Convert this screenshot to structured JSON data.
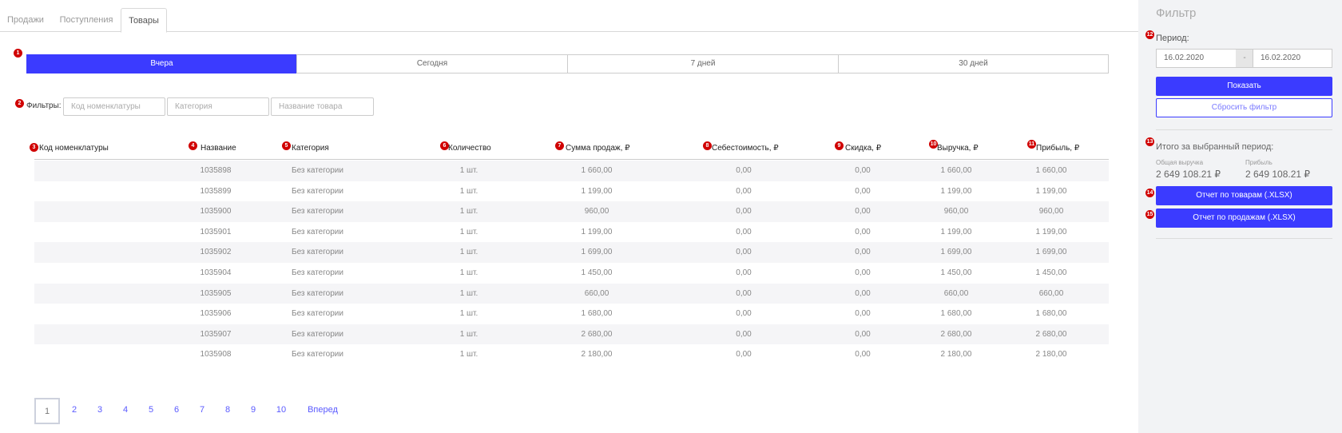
{
  "tabs": [
    "Продажи",
    "Поступления",
    "Товары"
  ],
  "markers": [
    "1",
    "2",
    "3",
    "4",
    "5",
    "6",
    "7",
    "8",
    "9",
    "10",
    "11",
    "12",
    "13",
    "14",
    "15"
  ],
  "periods": [
    "Вчера",
    "Сегодня",
    "7 дней",
    "30 дней"
  ],
  "filters": {
    "label": "Фильтры:",
    "code_placeholder": "Код номенклатуры",
    "category_placeholder": "Категория",
    "name_placeholder": "Название товара"
  },
  "columns": [
    "Код номенклатуры",
    "Название",
    "Категория",
    "Количество",
    "Сумма продаж, ₽",
    "Себестоимость, ₽",
    "Скидка, ₽",
    "Выручка, ₽",
    "Прибыль, ₽"
  ],
  "rows": [
    {
      "code": "",
      "name": "1035898",
      "category": "Без категории",
      "qty": "1 шт.",
      "sum": "1 660,00",
      "cost": "0,00",
      "discount": "0,00",
      "revenue": "1 660,00",
      "profit": "1 660,00"
    },
    {
      "code": "",
      "name": "1035899",
      "category": "Без категории",
      "qty": "1 шт.",
      "sum": "1 199,00",
      "cost": "0,00",
      "discount": "0,00",
      "revenue": "1 199,00",
      "profit": "1 199,00"
    },
    {
      "code": "",
      "name": "1035900",
      "category": "Без категории",
      "qty": "1 шт.",
      "sum": "960,00",
      "cost": "0,00",
      "discount": "0,00",
      "revenue": "960,00",
      "profit": "960,00"
    },
    {
      "code": "",
      "name": "1035901",
      "category": "Без категории",
      "qty": "1 шт.",
      "sum": "1 199,00",
      "cost": "0,00",
      "discount": "0,00",
      "revenue": "1 199,00",
      "profit": "1 199,00"
    },
    {
      "code": "",
      "name": "1035902",
      "category": "Без категории",
      "qty": "1 шт.",
      "sum": "1 699,00",
      "cost": "0,00",
      "discount": "0,00",
      "revenue": "1 699,00",
      "profit": "1 699,00"
    },
    {
      "code": "",
      "name": "1035904",
      "category": "Без категории",
      "qty": "1 шт.",
      "sum": "1 450,00",
      "cost": "0,00",
      "discount": "0,00",
      "revenue": "1 450,00",
      "profit": "1 450,00"
    },
    {
      "code": "",
      "name": "1035905",
      "category": "Без категории",
      "qty": "1 шт.",
      "sum": "660,00",
      "cost": "0,00",
      "discount": "0,00",
      "revenue": "660,00",
      "profit": "660,00"
    },
    {
      "code": "",
      "name": "1035906",
      "category": "Без категории",
      "qty": "1 шт.",
      "sum": "1 680,00",
      "cost": "0,00",
      "discount": "0,00",
      "revenue": "1 680,00",
      "profit": "1 680,00"
    },
    {
      "code": "",
      "name": "1035907",
      "category": "Без категории",
      "qty": "1 шт.",
      "sum": "2 680,00",
      "cost": "0,00",
      "discount": "0,00",
      "revenue": "2 680,00",
      "profit": "2 680,00"
    },
    {
      "code": "",
      "name": "1035908",
      "category": "Без категории",
      "qty": "1 шт.",
      "sum": "2 180,00",
      "cost": "0,00",
      "discount": "0,00",
      "revenue": "2 180,00",
      "profit": "2 180,00"
    }
  ],
  "pagination": {
    "pages": [
      "1",
      "2",
      "3",
      "4",
      "5",
      "6",
      "7",
      "8",
      "9",
      "10"
    ],
    "next": "Вперед"
  },
  "sidebar": {
    "title": "Фильтр",
    "period_label": "Период:",
    "date_from": "16.02.2020",
    "date_sep": "-",
    "date_to": "16.02.2020",
    "show_button": "Показать",
    "reset_button": "Сбросить фильтр",
    "total_title": "Итого за выбранный период:",
    "revenue_label": "Общая выручка",
    "revenue_value": "2 649 108.21 ₽",
    "profit_label": "Прибыль",
    "profit_value": "2 649 108.21 ₽",
    "report_goods": "Отчет по товарам (.XLSX)",
    "report_sales": "Отчет по продажам (.XLSX)"
  },
  "colors": {
    "accent": "#3b3bff",
    "marker": "#d00000"
  }
}
